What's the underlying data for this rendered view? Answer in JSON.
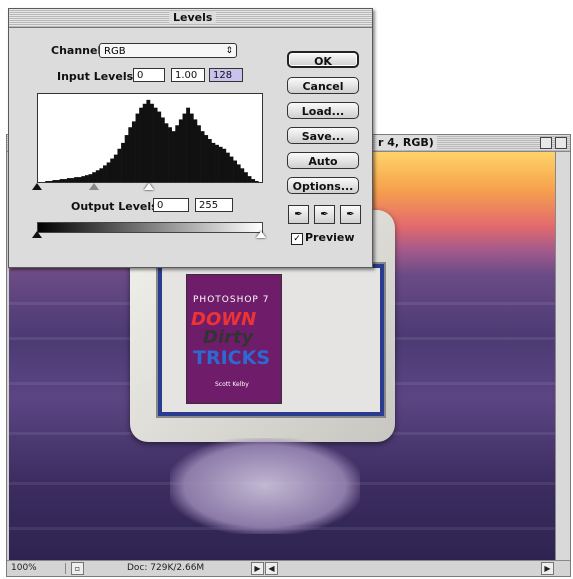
{
  "levels_dialog": {
    "title": "Levels",
    "channel_label": "Channel:",
    "channel_value": "RGB",
    "input_levels_label": "Input Levels:",
    "input_values": [
      "0",
      "1.00",
      "128"
    ],
    "output_levels_label": "Output Levels:",
    "output_values": [
      "0",
      "255"
    ],
    "buttons": {
      "ok": "OK",
      "cancel": "Cancel",
      "load": "Load...",
      "save": "Save...",
      "auto": "Auto",
      "options": "Options..."
    },
    "preview_label": "Preview",
    "preview_checked": true
  },
  "document_window": {
    "title": "r 4, RGB)",
    "zoom": "100%",
    "doc_size": "Doc: 729K/2.66M"
  },
  "book_cover": {
    "top_line": "PHOTOSHOP 7",
    "word1": "DOWN",
    "word2": "Dirty",
    "word3": "TRICKS",
    "author": "Scott Kelby"
  },
  "histogram": {
    "values": [
      0,
      0,
      1,
      1,
      2,
      2,
      3,
      3,
      4,
      4,
      5,
      5,
      6,
      7,
      8,
      10,
      12,
      14,
      17,
      20,
      24,
      28,
      34,
      40,
      48,
      56,
      62,
      70,
      76,
      80,
      84,
      80,
      76,
      72,
      66,
      60,
      56,
      52,
      58,
      64,
      70,
      76,
      70,
      64,
      58,
      52,
      48,
      44,
      40,
      38,
      36,
      34,
      30,
      26,
      22,
      18,
      14,
      10,
      6,
      3,
      1,
      0
    ]
  },
  "colors": {
    "accent": "#7a63a3",
    "dialog_bg": "#dcdcdc",
    "sky_top": "#ffd36a",
    "sea": "#4c3a74"
  }
}
